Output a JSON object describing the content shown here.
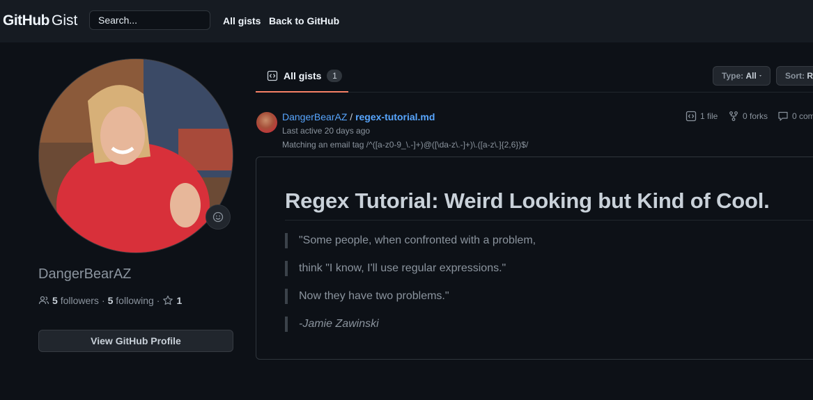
{
  "header": {
    "logo_github": "GitHub",
    "logo_gist": "Gist",
    "search_placeholder": "Search...",
    "nav": [
      "All gists",
      "Back to GitHub"
    ]
  },
  "profile": {
    "username": "DangerBearAZ",
    "followers_count": "5",
    "followers_label": "followers",
    "following_count": "5",
    "following_label": "following",
    "stars_count": "1",
    "view_profile_label": "View GitHub Profile",
    "icons": [
      "people-icon",
      "star-icon",
      "smiley-icon"
    ]
  },
  "tabs": {
    "active_label": "All gists",
    "active_count": "1",
    "type_label": "Type:",
    "type_value": "All",
    "sort_label": "Sort:",
    "sort_value": "Re"
  },
  "gist": {
    "owner": "DangerBearAZ",
    "separator": "/",
    "filename": "regex-tutorial.md",
    "last_active": "Last active 20 days ago",
    "description": "Matching an email tag /^([a-z0-9_\\.-]+)@([\\da-z\\.-]+)\\.([a-z\\.]{2,6})$/",
    "files": "1 file",
    "forks": "0 forks",
    "comments": "0 com"
  },
  "content": {
    "heading": "Regex Tutorial: Weird Looking but Kind of Cool.",
    "quote_lines": [
      "\"Some people, when confronted with a problem,",
      "think \"I know, I'll use regular expressions.\"",
      "Now they have two problems.\""
    ],
    "attribution": "-Jamie Zawinski"
  },
  "colors": {
    "background": "#0d1117",
    "header_bg": "#161b22",
    "link": "#58a6ff",
    "tab_underline": "#f78166",
    "border": "#30363d"
  }
}
